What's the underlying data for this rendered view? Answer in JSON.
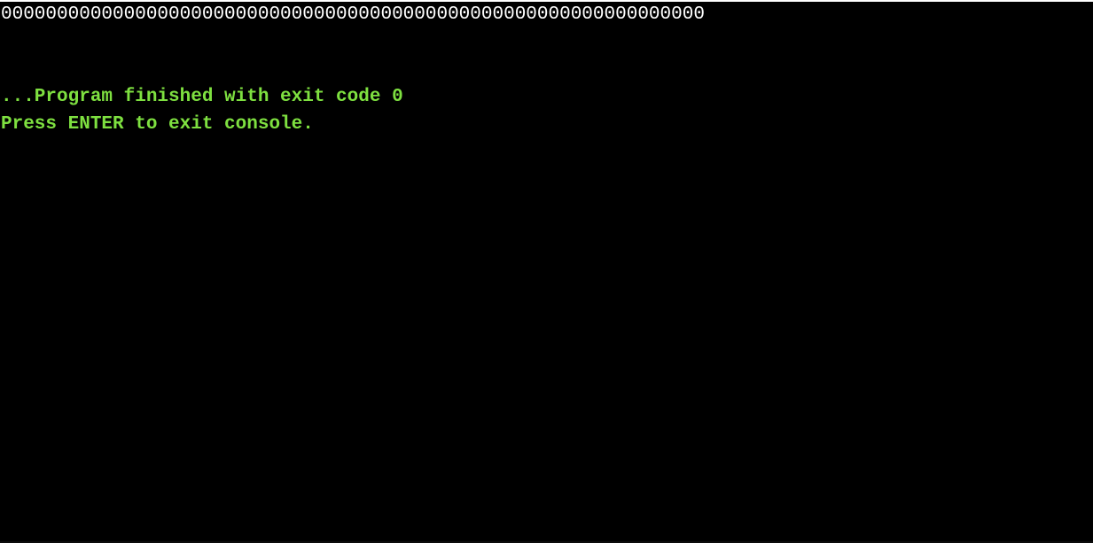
{
  "console": {
    "program_output": "000000000000000000000000000000000000000000000000000000000000000",
    "status_line_1": "...Program finished with exit code 0",
    "status_line_2": "Press ENTER to exit console.",
    "colors": {
      "background": "#000000",
      "output_text": "#ffffff",
      "status_text": "#7ee040"
    }
  }
}
